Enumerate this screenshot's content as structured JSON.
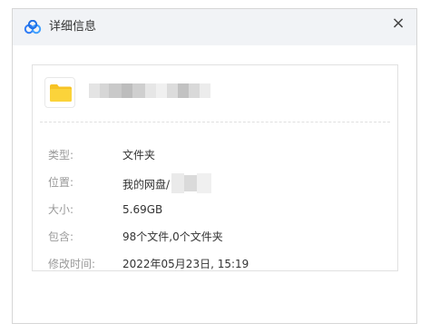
{
  "dialog": {
    "title": "详细信息",
    "close_glyph": "×"
  },
  "icons": {
    "app": "cloud-logo-icon",
    "folder": "folder-icon",
    "close": "close-icon"
  },
  "details": [
    {
      "key": "type",
      "label": "类型:",
      "value": "文件夹"
    },
    {
      "key": "location",
      "label": "位置:",
      "value": "我的网盘/"
    },
    {
      "key": "size",
      "label": "大小:",
      "value": "5.69GB"
    },
    {
      "key": "contains",
      "label": "包含:",
      "value": "98个文件,0个文件夹"
    },
    {
      "key": "modified",
      "label": "修改时间:",
      "value": "2022年05月23日, 15:19"
    }
  ],
  "colors": {
    "titlebar_bg": "#f1f3f6",
    "label_text": "#999999",
    "value_text": "#333333",
    "folder_yellow": "#f7c325",
    "logo_blue": "#2f7cf6"
  }
}
